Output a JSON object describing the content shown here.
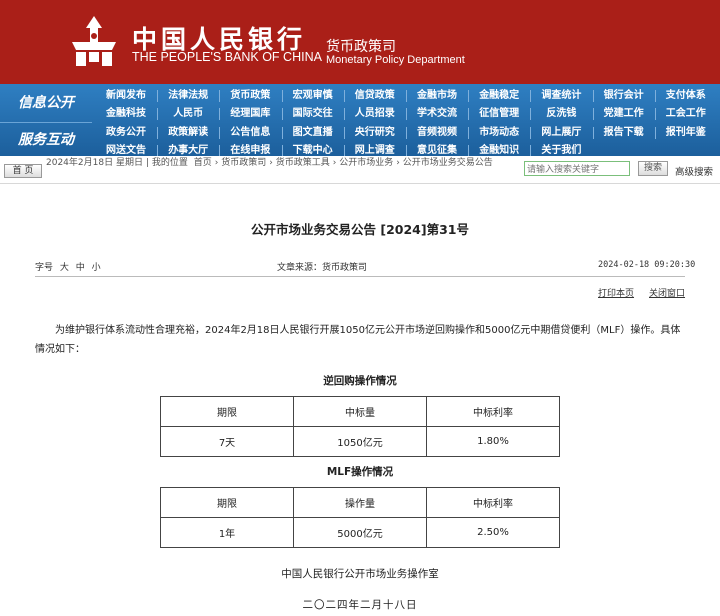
{
  "header": {
    "bank_name_cn": "中国人民银行",
    "bank_name_en": "THE PEOPLE'S BANK OF CHINA",
    "dept_cn": "货币政策司",
    "dept_en": "Monetary Policy Department",
    "brand_color": "#aa1f18",
    "logo_icon": "pboc-emblem-icon"
  },
  "nav": {
    "info_label": "信息公开",
    "service_label": "服务互动",
    "row1": [
      "新闻发布",
      "法律法规",
      "货币政策",
      "宏观审慎",
      "信贷政策",
      "金融市场",
      "金融稳定",
      "调查统计",
      "银行会计",
      "支付体系"
    ],
    "row2": [
      "金融科技",
      "人民币",
      "经理国库",
      "国际交往",
      "人员招录",
      "学术交流",
      "征信管理",
      "反洗钱",
      "党建工作",
      "工会工作"
    ],
    "row3": [
      "政务公开",
      "政策解读",
      "公告信息",
      "图文直播",
      "央行研究",
      "音频视频",
      "市场动态",
      "网上展厅",
      "报告下载",
      "报刊年鉴"
    ],
    "row4": [
      "网送文告",
      "办事大厅",
      "在线申报",
      "下载中心",
      "网上调查",
      "意见征集",
      "金融知识",
      "关于我们"
    ],
    "bg_color": "#2a74b6"
  },
  "crumb": {
    "home_label": "首 页",
    "date": "2024年2月18日 星期日",
    "prefix": "我的位置",
    "items": [
      "首页",
      "货币政策司",
      "货币政策工具",
      "公开市场业务",
      "公开市场业务交易公告"
    ],
    "search_placeholder": "请输入搜索关键字",
    "search_label": "搜索",
    "advanced_label": "高级搜索"
  },
  "article": {
    "title": "公开市场业务交易公告 [2024]第31号",
    "font_size_label": "字号",
    "size_options": [
      "大",
      "中",
      "小"
    ],
    "source": "文章来源：货币政策司",
    "date": "2024-02-18 09:20:30",
    "print_label": "打印本页",
    "close_label": "关闭窗口",
    "paragraph": "为维护银行体系流动性合理充裕，2024年2月18日人民银行开展1050亿元公开市场逆回购操作和5000亿元中期借贷便利（MLF）操作。具体情况如下：",
    "repo_table": {
      "title": "逆回购操作情况",
      "headers": [
        "期限",
        "中标量",
        "中标利率"
      ],
      "rows": [
        [
          "7天",
          "1050亿元",
          "1.80%"
        ]
      ]
    },
    "mlf_table": {
      "title": "MLF操作情况",
      "headers": [
        "期限",
        "操作量",
        "中标利率"
      ],
      "rows": [
        [
          "1年",
          "5000亿元",
          "2.50%"
        ]
      ]
    },
    "signature_office": "中国人民银行公开市场业务操作室",
    "signature_date": "二〇二四年二月十八日"
  }
}
